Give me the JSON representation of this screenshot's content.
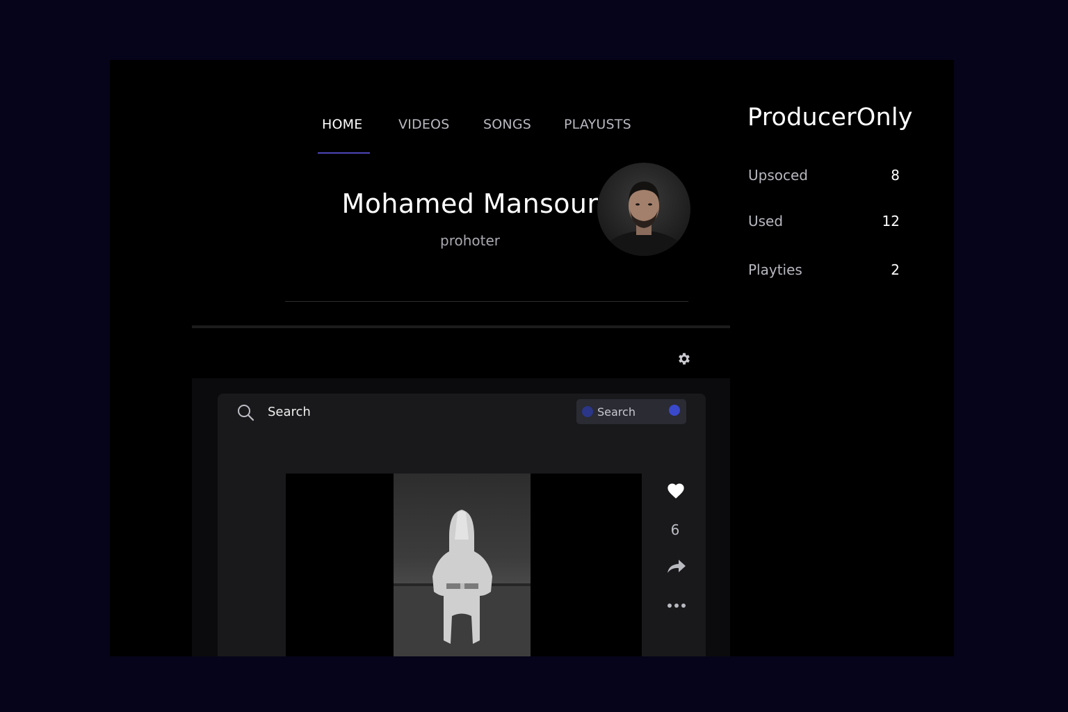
{
  "nav": {
    "items": [
      {
        "label": "HOME",
        "active": true
      },
      {
        "label": "VIDEOS",
        "active": false
      },
      {
        "label": "SONGS",
        "active": false
      },
      {
        "label": "PLAYUSTS",
        "active": false
      }
    ],
    "accent_color": "#4d46b8"
  },
  "profile": {
    "name": "Mohamed Mansour",
    "role": "prohoter",
    "avatar_icon": "user-avatar-photo"
  },
  "sidebar": {
    "brand": "ProducerOnly",
    "stats": [
      {
        "label": "Upsoced",
        "value": "8"
      },
      {
        "label": "Used",
        "value": "12"
      },
      {
        "label": "Playties",
        "value": "2"
      }
    ]
  },
  "toolbar": {
    "settings_icon": "gear-icon"
  },
  "search": {
    "label": "Search",
    "chip_label": "Search",
    "chip_color": "#3a49c9"
  },
  "player": {
    "like_count": "6",
    "actions": [
      "heart-icon",
      "share-icon",
      "more-icon"
    ]
  },
  "colors": {
    "background": "#06041a",
    "frame": "#000000",
    "panel": "#19191b"
  }
}
